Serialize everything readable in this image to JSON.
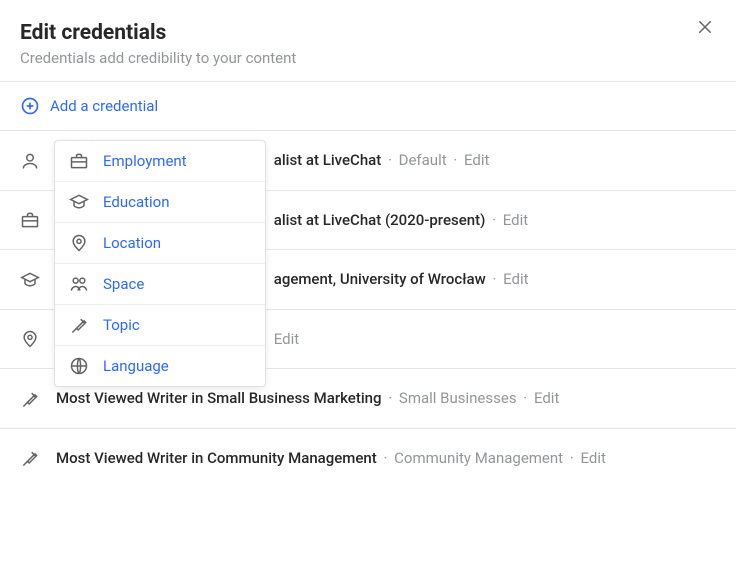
{
  "header": {
    "title": "Edit credentials",
    "subtitle": "Credentials add credibility to your content"
  },
  "add_row": {
    "label": "Add a credential"
  },
  "dropdown": {
    "items": [
      {
        "label": "Employment",
        "icon": "briefcase-icon"
      },
      {
        "label": "Education",
        "icon": "graduation-cap-icon"
      },
      {
        "label": "Location",
        "icon": "location-pin-icon"
      },
      {
        "label": "Space",
        "icon": "people-group-icon"
      },
      {
        "label": "Topic",
        "icon": "topic-flag-icon"
      },
      {
        "label": "Language",
        "icon": "globe-icon"
      }
    ]
  },
  "credentials": [
    {
      "icon": "person-icon",
      "main_visible": "alist at LiveChat",
      "meta_text": "Default",
      "edit": "Edit"
    },
    {
      "icon": "briefcase-icon",
      "main_visible": "alist at LiveChat (2020-present)",
      "meta_text": null,
      "edit": "Edit"
    },
    {
      "icon": "graduation-cap-icon",
      "main_visible": "agement, University of Wrocław",
      "meta_text": null,
      "edit": "Edit"
    },
    {
      "icon": "location-pin-icon",
      "main_visible": "",
      "meta_text": null,
      "edit": "Edit"
    },
    {
      "icon": "topic-flag-icon",
      "main_visible": "Most Viewed Writer in Small Business Marketing",
      "meta_text": "Small Businesses",
      "edit": "Edit"
    },
    {
      "icon": "topic-flag-icon",
      "main_visible": "Most Viewed Writer in Community Management",
      "meta_text": "Community Management",
      "edit": "Edit"
    }
  ]
}
